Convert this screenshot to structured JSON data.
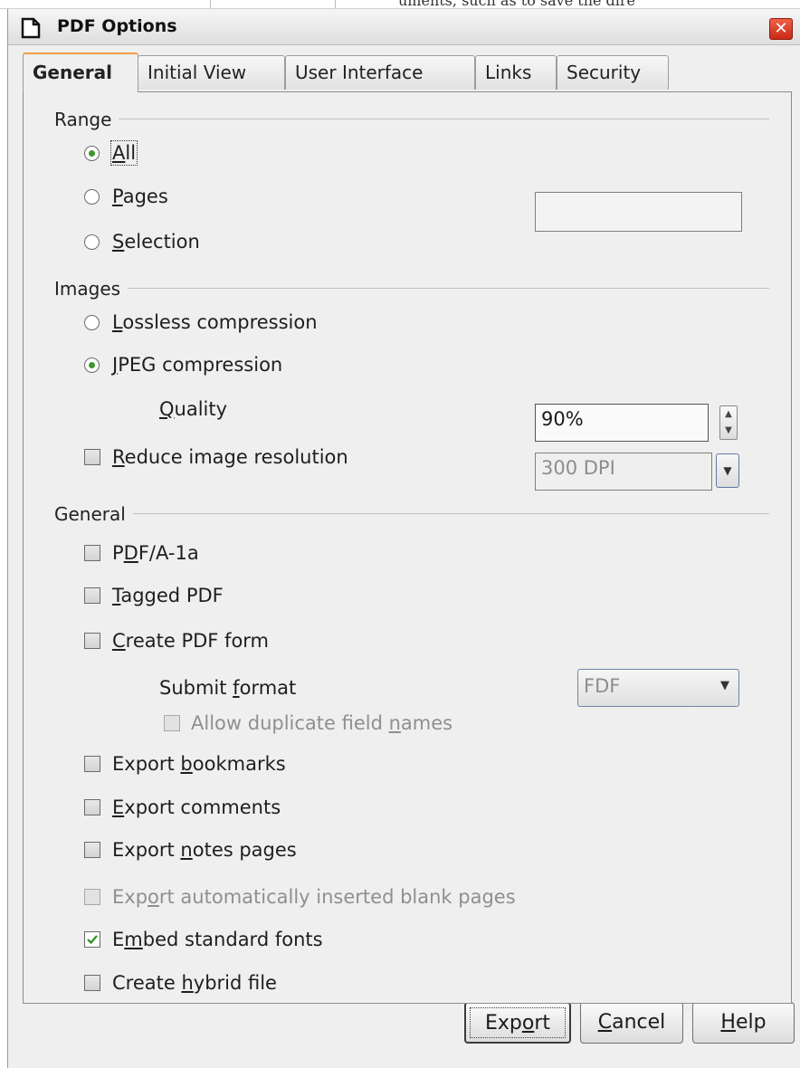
{
  "background": {
    "text": "uments, such as to save the dire"
  },
  "window": {
    "title": "PDF Options",
    "close_glyph": "✕"
  },
  "tabs": [
    {
      "label": "General",
      "active": true
    },
    {
      "label": "Initial View",
      "active": false
    },
    {
      "label": "User Interface",
      "active": false
    },
    {
      "label": "Links",
      "active": false
    },
    {
      "label": "Security",
      "active": false
    }
  ],
  "range": {
    "title": "Range",
    "all": {
      "label_u": "A",
      "label_rest": "ll",
      "selected": true
    },
    "pages": {
      "label_u": "P",
      "label_rest": "ages",
      "selected": false,
      "value": ""
    },
    "selection": {
      "label_u": "S",
      "label_rest": "election",
      "selected": false
    }
  },
  "images": {
    "title": "Images",
    "lossless": {
      "label_u": "L",
      "label_rest": "ossless compression",
      "selected": false
    },
    "jpeg": {
      "label_u": "J",
      "label_rest": "PEG compression",
      "selected": true
    },
    "quality": {
      "label_u": "Q",
      "label_rest": "uality",
      "value": "90%"
    },
    "reduce": {
      "label_u": "R",
      "label_rest": "educe image resolution",
      "checked": false,
      "value": "300 DPI"
    }
  },
  "general": {
    "title": "General",
    "pdfa": {
      "pre": "P",
      "u": "D",
      "post": "F/A-1a",
      "checked": false
    },
    "tagged": {
      "pre": "",
      "u": "T",
      "post": "agged PDF",
      "checked": false
    },
    "create_form": {
      "pre": "",
      "u": "C",
      "post": "reate PDF form",
      "checked": false
    },
    "submit_format": {
      "pre": "Submit ",
      "u": "f",
      "post": "ormat",
      "value": "FDF"
    },
    "allow_duplicate": {
      "pre": "Allow duplicate field ",
      "u": "n",
      "post": "ames",
      "checked": false
    },
    "bookmarks": {
      "pre": "Export ",
      "u": "b",
      "post": "ookmarks",
      "checked": false
    },
    "comments": {
      "pre": "",
      "u": "E",
      "post": "xport comments",
      "checked": false
    },
    "notes": {
      "pre": "Export ",
      "u": "n",
      "post": "otes pages",
      "checked": false
    },
    "blank_pages": {
      "pre": "Exp",
      "u": "o",
      "post": "rt automatically inserted blank pages",
      "checked": false
    },
    "embed_fonts": {
      "pre": "E",
      "u": "m",
      "post": "bed standard fonts",
      "checked": true
    },
    "hybrid": {
      "pre": "Create ",
      "u": "h",
      "post": "ybrid file",
      "checked": false
    }
  },
  "buttons": {
    "export": {
      "pre": "Exp",
      "u": "o",
      "post": "rt"
    },
    "cancel": {
      "pre": "",
      "u": "C",
      "post": "ancel"
    },
    "help": {
      "pre": "",
      "u": "H",
      "post": "elp"
    }
  },
  "icons": {
    "spin_up": "▲",
    "spin_down": "▼",
    "dropdown": "▼"
  },
  "colors": {
    "radio_dot": "#3a9a2a",
    "close_button": "#d9361e",
    "active_tab_accent": "#f0a040"
  }
}
